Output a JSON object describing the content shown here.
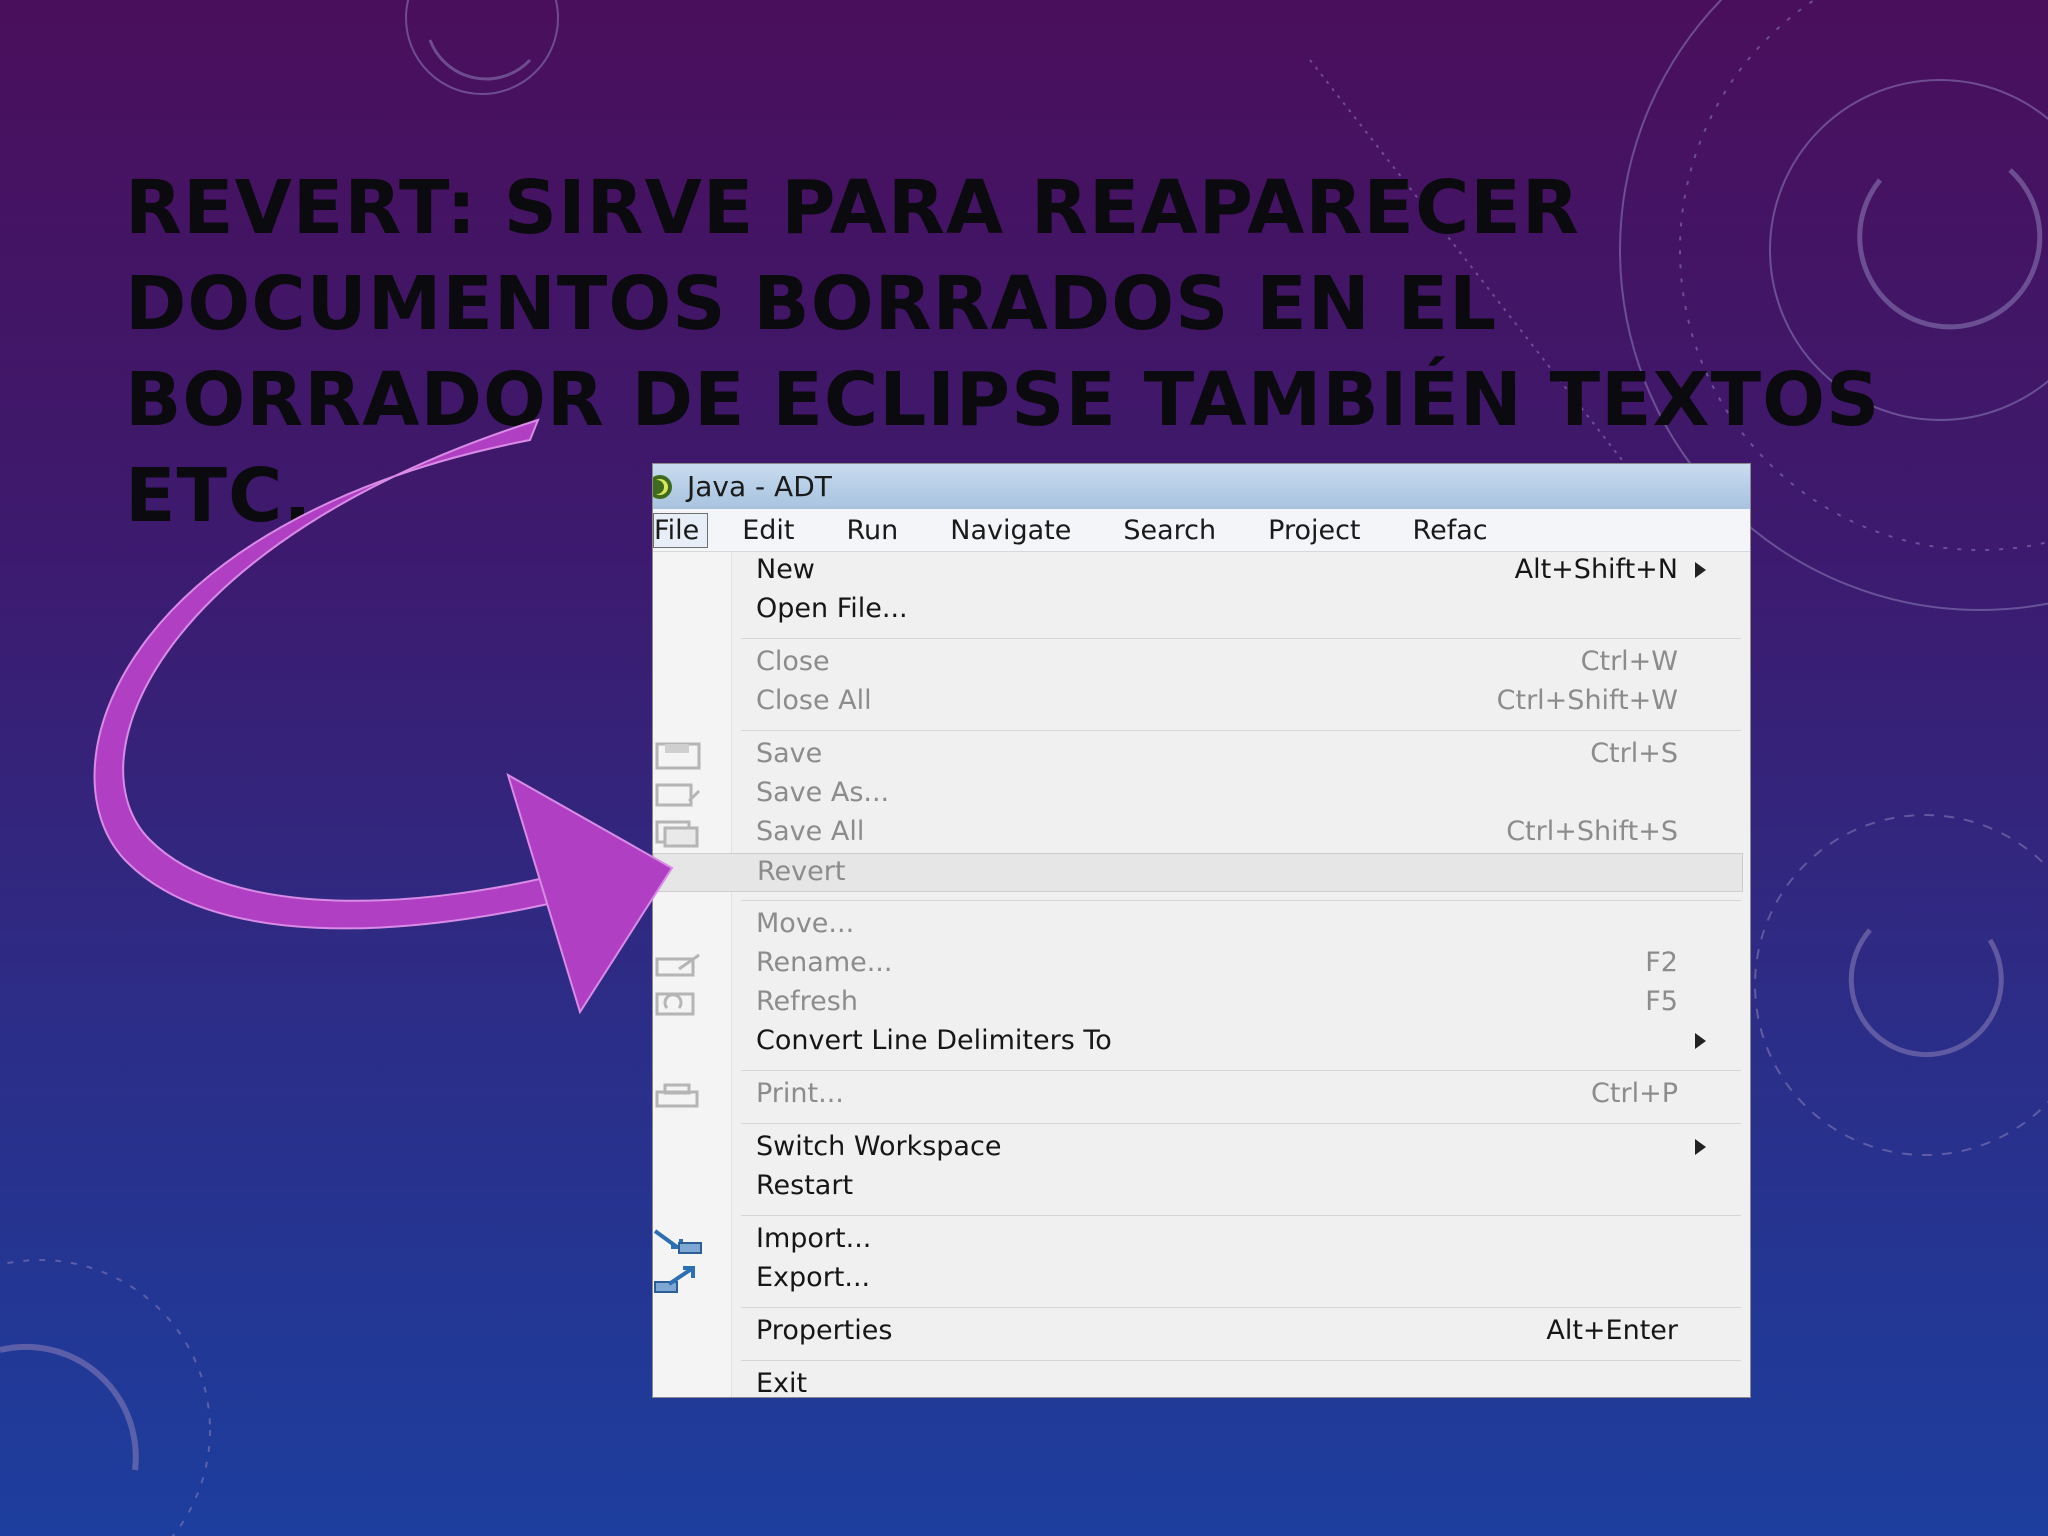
{
  "slide": {
    "title": "REVERT: SIRVE PARA REAPARECER DOCUMENTOS BORRADOS EN EL BORRADOR DE ECLIPSE TAMBIÉN TEXTOS ETC."
  },
  "window": {
    "title": "Java - ADT"
  },
  "menubar": [
    "File",
    "Edit",
    "Run",
    "Navigate",
    "Search",
    "Project",
    "Refac"
  ],
  "menu": {
    "items": [
      {
        "label": "New",
        "shortcut": "Alt+Shift+N",
        "submenu": true,
        "enabled": true
      },
      {
        "label": "Open File...",
        "shortcut": "",
        "enabled": true
      },
      {
        "label": "Close",
        "shortcut": "Ctrl+W",
        "enabled": false
      },
      {
        "label": "Close All",
        "shortcut": "Ctrl+Shift+W",
        "enabled": false
      },
      {
        "label": "Save",
        "shortcut": "Ctrl+S",
        "enabled": false,
        "icon": "save-icon"
      },
      {
        "label": "Save As...",
        "shortcut": "",
        "enabled": false,
        "icon": "save-as-icon"
      },
      {
        "label": "Save All",
        "shortcut": "Ctrl+Shift+S",
        "enabled": false,
        "icon": "save-all-icon"
      },
      {
        "label": "Revert",
        "shortcut": "",
        "enabled": false,
        "highlighted": true
      },
      {
        "label": "Move...",
        "shortcut": "",
        "enabled": false
      },
      {
        "label": "Rename...",
        "shortcut": "F2",
        "enabled": false,
        "icon": "rename-icon"
      },
      {
        "label": "Refresh",
        "shortcut": "F5",
        "enabled": false,
        "icon": "refresh-icon"
      },
      {
        "label": "Convert Line Delimiters To",
        "shortcut": "",
        "submenu": true,
        "enabled": true
      },
      {
        "label": "Print...",
        "shortcut": "Ctrl+P",
        "enabled": false,
        "icon": "print-icon"
      },
      {
        "label": "Switch Workspace",
        "shortcut": "",
        "submenu": true,
        "enabled": true
      },
      {
        "label": "Restart",
        "shortcut": "",
        "enabled": true
      },
      {
        "label": "Import...",
        "shortcut": "",
        "enabled": true,
        "icon": "import-icon"
      },
      {
        "label": "Export...",
        "shortcut": "",
        "enabled": true,
        "icon": "export-icon"
      },
      {
        "label": "Properties",
        "shortcut": "Alt+Enter",
        "enabled": true
      },
      {
        "label": "Exit",
        "shortcut": "",
        "enabled": true
      }
    ]
  },
  "colors": {
    "arrow": "#b03fc4",
    "title_text": "#0b0b0f"
  }
}
